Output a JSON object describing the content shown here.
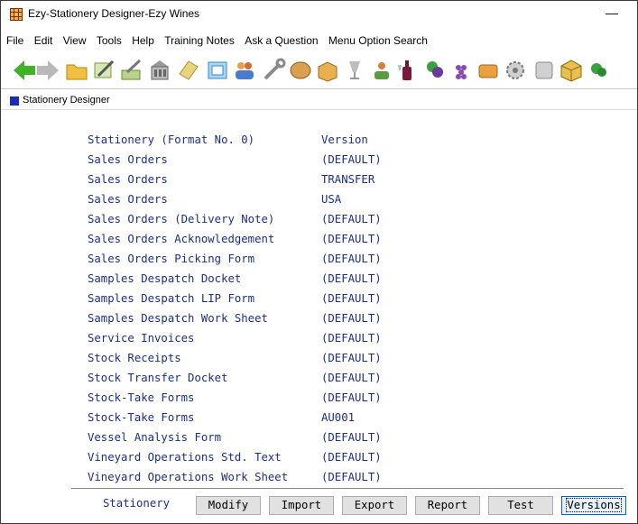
{
  "window": {
    "title": "Ezy-Stationery Designer-Ezy Wines",
    "minimize_glyph": "—"
  },
  "menu": [
    "File",
    "Edit",
    "View",
    "Tools",
    "Help",
    "Training Notes",
    "Ask a Question",
    "Menu Option Search"
  ],
  "toolbar_icons": [
    "back-arrow-icon",
    "forward-arrow-icon",
    "folder-icon",
    "edit-icon",
    "pen-icon",
    "building-icon",
    "tag-icon",
    "note-icon",
    "people-icon",
    "wrench-icon",
    "barrel-icon",
    "box-icon",
    "glass-icon",
    "person-icon",
    "wine-bottle-icon",
    "plant-icon",
    "grapes-icon",
    "cellar-icon",
    "gear-icon",
    "monitor-icon",
    "cube-icon",
    "leaf-icon"
  ],
  "subwindow": {
    "label": "Stationery Designer"
  },
  "header": {
    "name": "Stationery (Format No. 0)",
    "version": "Version"
  },
  "rows": [
    {
      "name": "Sales Orders",
      "version": "(DEFAULT)"
    },
    {
      "name": "Sales Orders",
      "version": "TRANSFER"
    },
    {
      "name": "Sales Orders",
      "version": "USA"
    },
    {
      "name": "Sales Orders (Delivery Note)",
      "version": "(DEFAULT)"
    },
    {
      "name": "Sales Orders Acknowledgement",
      "version": "(DEFAULT)"
    },
    {
      "name": "Sales Orders Picking Form",
      "version": "(DEFAULT)"
    },
    {
      "name": "Samples Despatch Docket",
      "version": "(DEFAULT)"
    },
    {
      "name": "Samples Despatch LIP Form",
      "version": "(DEFAULT)"
    },
    {
      "name": "Samples Despatch Work Sheet",
      "version": "(DEFAULT)"
    },
    {
      "name": "Service Invoices",
      "version": "(DEFAULT)"
    },
    {
      "name": "Stock Receipts",
      "version": "(DEFAULT)"
    },
    {
      "name": "Stock Transfer Docket",
      "version": "(DEFAULT)"
    },
    {
      "name": "Stock-Take Forms",
      "version": "(DEFAULT)"
    },
    {
      "name": "Stock-Take Forms",
      "version": "AU001"
    },
    {
      "name": "Vessel Analysis Form",
      "version": "(DEFAULT)"
    },
    {
      "name": "Vineyard Operations Std. Text",
      "version": "(DEFAULT)"
    },
    {
      "name": "Vineyard Operations Work Sheet",
      "version": "(DEFAULT)"
    }
  ],
  "footer": {
    "label": "Stationery",
    "buttons": {
      "modify": "Modify",
      "import": "Import",
      "export": "Export",
      "report": "Report",
      "test": "Test",
      "versions": "Versions"
    }
  },
  "colors": {
    "text_blue": "#1d2f80",
    "accent": "#1530b5"
  }
}
